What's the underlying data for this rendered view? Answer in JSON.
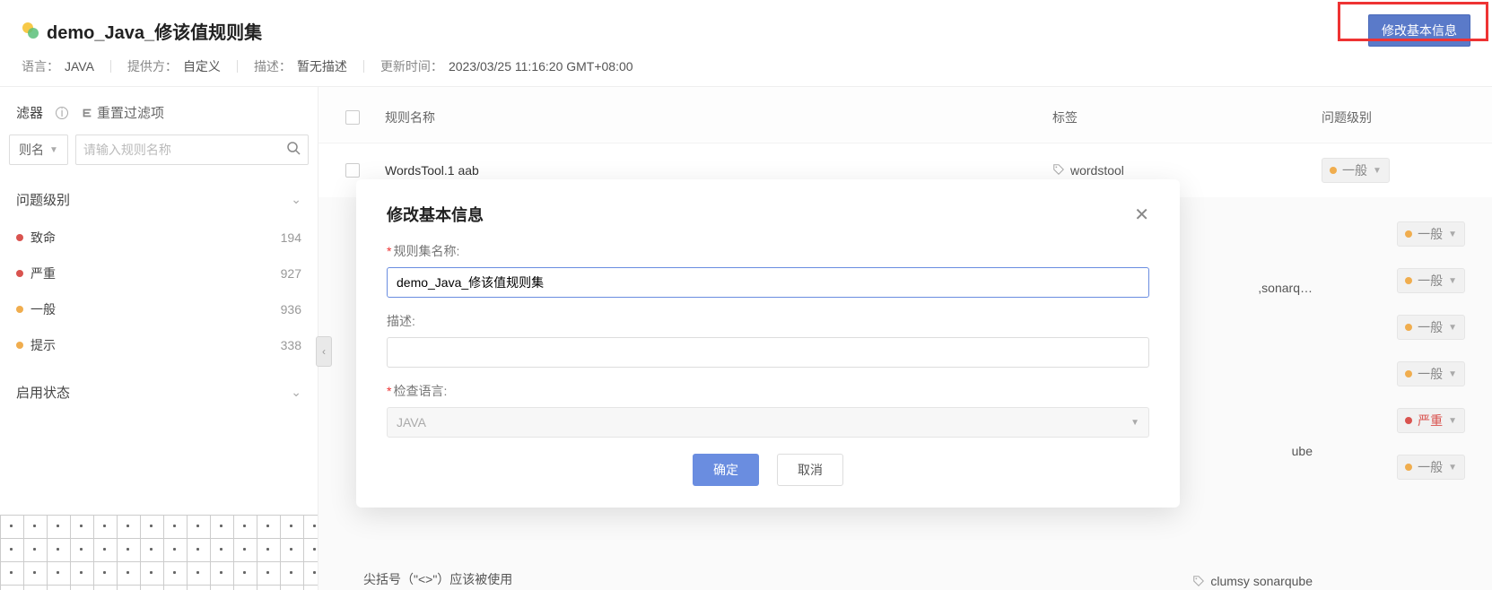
{
  "header": {
    "title": "demo_Java_修该值规则集",
    "edit_btn": "修改基本信息",
    "meta": {
      "lang_label": "语言：",
      "lang_value": "JAVA",
      "provider_label": "提供方：",
      "provider_value": "自定义",
      "desc_label": "描述：",
      "desc_value": "暂无描述",
      "updated_label": "更新时间：",
      "updated_value": "2023/03/25 11:16:20 GMT+08:00"
    }
  },
  "sidebar": {
    "filter_title": "滤器",
    "reset_label": "重置过滤项",
    "rule_name_select": "则名",
    "search_placeholder": "请输入规则名称",
    "sections": {
      "level": {
        "title": "问题级别",
        "items": [
          {
            "label": "致命",
            "count": "194"
          },
          {
            "label": "严重",
            "count": "927"
          },
          {
            "label": "一般",
            "count": "936"
          },
          {
            "label": "提示",
            "count": "338"
          }
        ]
      },
      "status": {
        "title": "启用状态"
      }
    }
  },
  "table": {
    "headers": {
      "name": "规则名称",
      "tag": "标签",
      "level": "问题级别"
    },
    "rows": [
      {
        "name": "WordsTool.1 aab",
        "tag": "wordstool",
        "level": "一般"
      }
    ],
    "right_tags": {
      "sonarq": ",sonarq…",
      "ube": "ube",
      "clumsy": "clumsy sonarqube"
    },
    "level_pills": [
      "一般",
      "一般",
      "一般",
      "一般",
      "一般",
      "严重",
      "一般"
    ],
    "bottom_partial": "尖括号（\"<>\"）应该被使用"
  },
  "modal": {
    "title": "修改基本信息",
    "fields": {
      "name_label": "规则集名称:",
      "name_value": "demo_Java_修该值规则集",
      "desc_label": "描述:",
      "desc_value": "",
      "lang_label": "检查语言:",
      "lang_value": "JAVA"
    },
    "confirm": "确定",
    "cancel": "取消"
  }
}
